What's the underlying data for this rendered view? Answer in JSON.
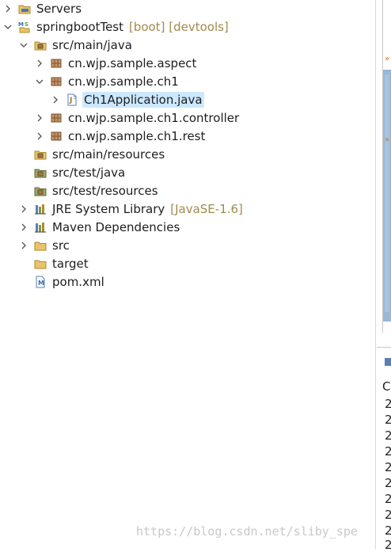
{
  "tree": {
    "servers": {
      "label": "Servers",
      "icon": "folder-server-icon"
    },
    "project": {
      "label": "springbootTest",
      "decoration": "[boot] [devtools]",
      "icon": "spring-project-icon"
    },
    "src_main_java": {
      "label": "src/main/java",
      "icon": "source-folder-icon"
    },
    "pkg_aspect": {
      "label": "cn.wjp.sample.aspect",
      "icon": "package-icon"
    },
    "pkg_ch1": {
      "label": "cn.wjp.sample.ch1",
      "icon": "package-icon"
    },
    "ch1app": {
      "label": "Ch1Application.java",
      "icon": "java-file-icon",
      "selected": true
    },
    "pkg_controller": {
      "label": "cn.wjp.sample.ch1.controller",
      "icon": "package-icon"
    },
    "pkg_rest": {
      "label": "cn.wjp.sample.ch1.rest",
      "icon": "package-icon"
    },
    "src_main_resources": {
      "label": "src/main/resources",
      "icon": "source-folder-icon"
    },
    "src_test_java": {
      "label": "src/test/java",
      "icon": "source-folder-icon"
    },
    "src_test_resources": {
      "label": "src/test/resources",
      "icon": "source-folder-icon"
    },
    "jre": {
      "label": "JRE System Library",
      "decoration": "[JavaSE-1.6]",
      "icon": "library-icon"
    },
    "maven": {
      "label": "Maven Dependencies",
      "icon": "library-icon"
    },
    "src": {
      "label": "src",
      "icon": "folder-icon"
    },
    "target": {
      "label": "target",
      "icon": "folder-icon"
    },
    "pom": {
      "label": "pom.xml",
      "icon": "xml-file-icon"
    }
  },
  "right_panel": {
    "header": "C",
    "lines": [
      "2",
      "2",
      "2",
      "2",
      "2",
      "2",
      "2",
      "2",
      "2",
      "2"
    ]
  },
  "watermark": "https://blog.csdn.net/sliby_spe",
  "colors": {
    "selection": "#cce8ff",
    "decoration": "#a08a4c",
    "ruler": "#99b7d6"
  }
}
